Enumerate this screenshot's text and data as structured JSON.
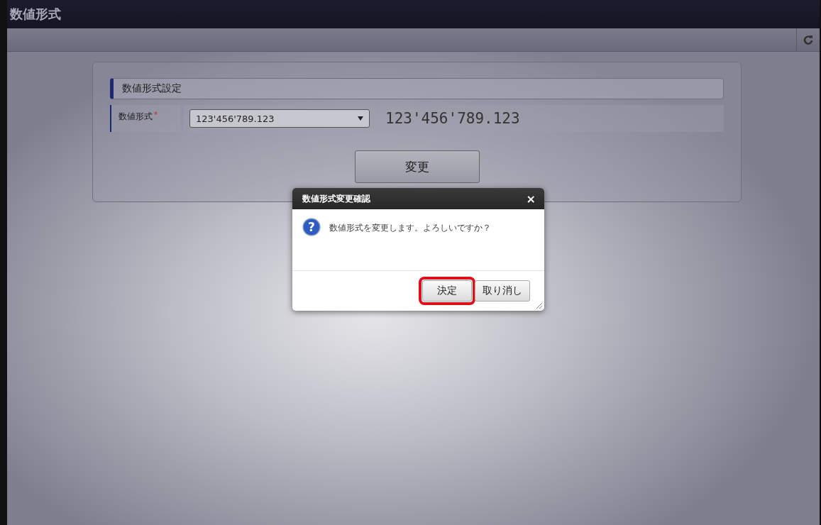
{
  "window": {
    "title": "数値形式"
  },
  "section": {
    "title": "数値形式設定"
  },
  "field": {
    "label": "数値形式",
    "required_mark": "*",
    "value": "123'456'789.123",
    "preview": "123'456'789.123"
  },
  "submit_button": "変更",
  "dialog": {
    "title": "数値形式変更確認",
    "close": "×",
    "icon": "?",
    "message": "数値形式を変更します。よろしいですか？",
    "buttons": [
      {
        "label": "決定",
        "highlighted": true
      },
      {
        "label": "取り消し",
        "highlighted": false
      }
    ]
  }
}
